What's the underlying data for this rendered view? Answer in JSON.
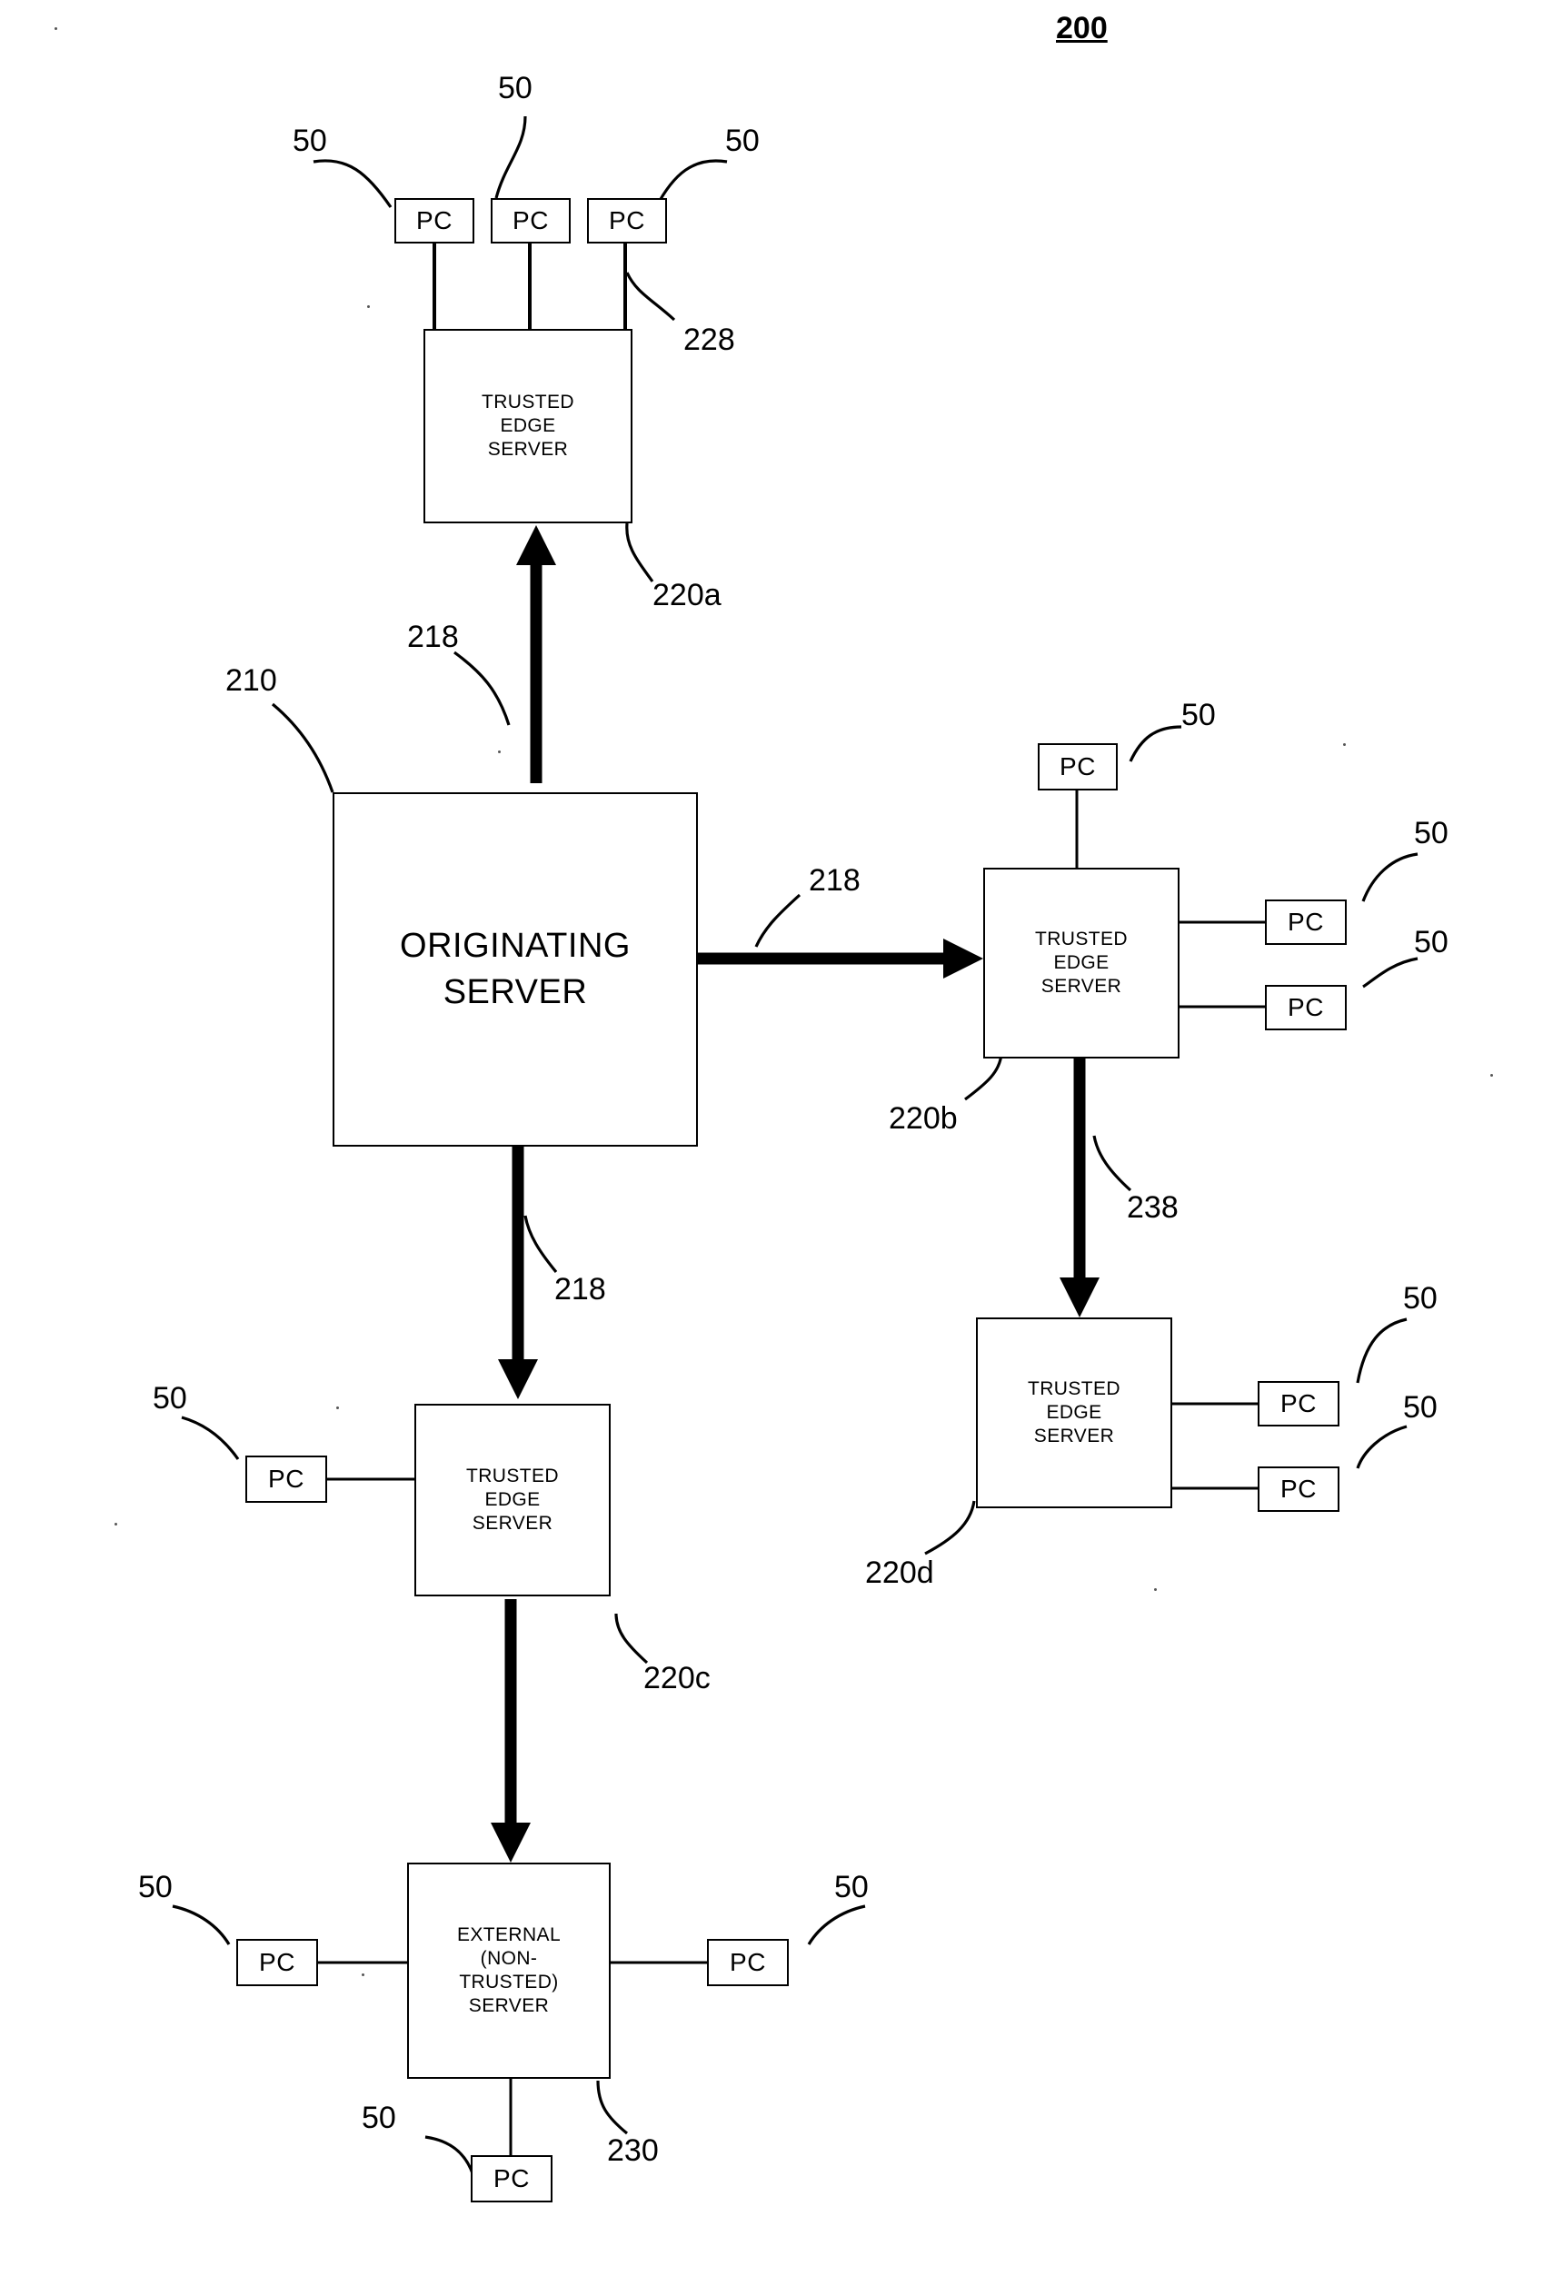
{
  "figure": {
    "number": "200"
  },
  "nodes": {
    "origin": {
      "label": "ORIGINATING SERVER",
      "line1": "ORIGINATING",
      "line2": "SERVER",
      "ref": "210"
    },
    "edge_a": {
      "line1": "TRUSTED",
      "line2": "EDGE",
      "line3": "SERVER",
      "ref": "220a"
    },
    "edge_b": {
      "line1": "TRUSTED",
      "line2": "EDGE",
      "line3": "SERVER",
      "ref": "220b"
    },
    "edge_c": {
      "line1": "TRUSTED",
      "line2": "EDGE",
      "line3": "SERVER",
      "ref": "220c"
    },
    "edge_d": {
      "line1": "TRUSTED",
      "line2": "EDGE",
      "line3": "SERVER",
      "ref": "220d"
    },
    "external": {
      "line1": "EXTERNAL",
      "line2": "(NON-",
      "line3": "TRUSTED)",
      "line4": "SERVER",
      "ref": "230"
    }
  },
  "pc": {
    "label": "PC",
    "ref": "50"
  },
  "refs": {
    "link_218_top": "218",
    "link_218_right": "218",
    "link_218_bottom": "218",
    "link_228": "228",
    "link_238": "238"
  },
  "pcs": [
    {
      "id": "pc-top-1",
      "label": "PC",
      "ref": "50"
    },
    {
      "id": "pc-top-2",
      "label": "PC",
      "ref": "50"
    },
    {
      "id": "pc-top-3",
      "label": "PC",
      "ref": "50"
    },
    {
      "id": "pc-b-top",
      "label": "PC",
      "ref": "50"
    },
    {
      "id": "pc-b-mid",
      "label": "PC",
      "ref": "50"
    },
    {
      "id": "pc-b-low",
      "label": "PC",
      "ref": "50"
    },
    {
      "id": "pc-d-top",
      "label": "PC",
      "ref": "50"
    },
    {
      "id": "pc-d-low",
      "label": "PC",
      "ref": "50"
    },
    {
      "id": "pc-c-left",
      "label": "PC",
      "ref": "50"
    },
    {
      "id": "pc-ext-left",
      "label": "PC",
      "ref": "50"
    },
    {
      "id": "pc-ext-right",
      "label": "PC",
      "ref": "50"
    },
    {
      "id": "pc-ext-bottom",
      "label": "PC",
      "ref": "50"
    }
  ]
}
